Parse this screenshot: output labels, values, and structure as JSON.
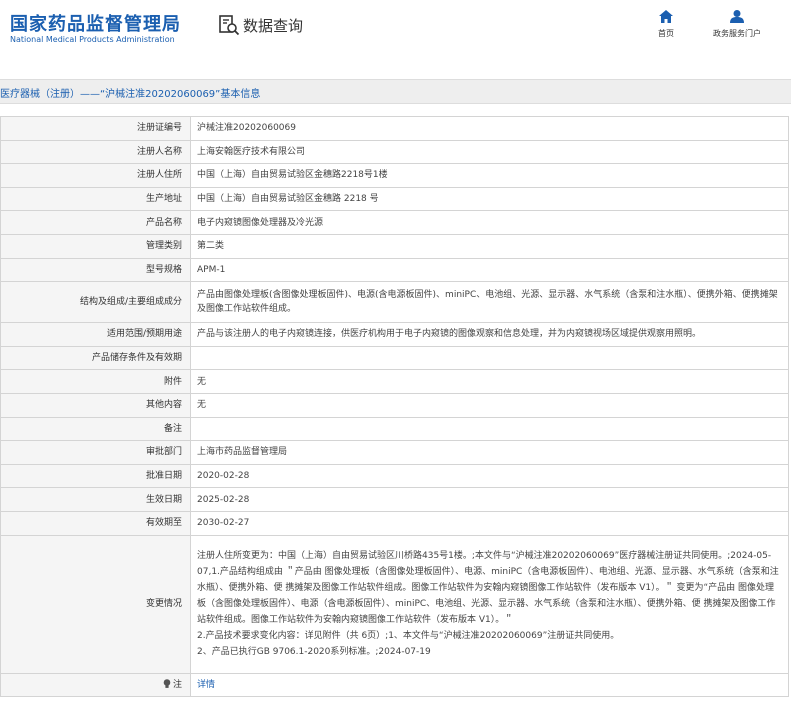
{
  "header": {
    "logo_cn": "国家药品监督管理局",
    "logo_en": "National Medical Products Administration",
    "query_label": "数据查询",
    "nav": [
      {
        "label": "首页",
        "icon": "home-icon"
      },
      {
        "label": "政务服务门户",
        "icon": "user-icon"
      }
    ]
  },
  "title": "医疗器械（注册）——“沪械注准20202060069”基本信息",
  "colors": {
    "brand": "#1b5fb0",
    "label_bg": "#f5f5f5",
    "border": "#d4d4d4"
  },
  "rows": [
    {
      "label": "注册证编号",
      "value": "沪械注准20202060069"
    },
    {
      "label": "注册人名称",
      "value": "上海安翰医疗技术有限公司"
    },
    {
      "label": "注册人住所",
      "value": "中国（上海）自由贸易试验区金穗路2218号1楼"
    },
    {
      "label": "生产地址",
      "value": "中国（上海）自由贸易试验区金穗路 2218 号"
    },
    {
      "label": "产品名称",
      "value": "电子内窥镜图像处理器及冷光源"
    },
    {
      "label": "管理类别",
      "value": "第二类"
    },
    {
      "label": "型号规格",
      "value": "APM-1"
    },
    {
      "label": "结构及组成/主要组成成分",
      "value": "产品由图像处理板(含图像处理板固件)、电源(含电源板固件)、miniPC、电池组、光源、显示器、水气系统（含泵和注水瓶）、便携外箱、便携摊架及图像工作站软件组成。"
    },
    {
      "label": "适用范围/预期用途",
      "value": "产品与该注册人的电子内窥镜连接，供医疗机构用于电子内窥镜的图像观察和信息处理，并为内窥镜视场区域提供观察用照明。"
    },
    {
      "label": "产品储存条件及有效期",
      "value": ""
    },
    {
      "label": "附件",
      "value": "无"
    },
    {
      "label": "其他内容",
      "value": "无"
    },
    {
      "label": "备注",
      "value": ""
    },
    {
      "label": "审批部门",
      "value": "上海市药品监督管理局"
    },
    {
      "label": "批准日期",
      "value": "2020-02-28"
    },
    {
      "label": "生效日期",
      "value": "2025-02-28"
    },
    {
      "label": "有效期至",
      "value": "2030-02-27"
    }
  ],
  "change": {
    "label": "变更情况",
    "paragraphs": [
      "注册人住所变更为：中国（上海）自由贸易试验区川桥路435号1楼。;本文件与“沪械注准20202060069”医疗器械注册证共同使用。;2024-05-07,1.产品结构组成由 ＂产品由 图像处理板（含图像处理板固件）、电源、miniPC（含电源板固件）、电池组、光源、显示器、水气系统（含泵和注水瓶）、便携外箱、便 携摊架及图像工作站软件组成。图像工作站软件为安翰内窥镜图像工作站软件（发布版本 V1）。＂ 变更为“产品由 图像处理板（含图像处理板固件）、电源（含电源板固件）、miniPC、电池组、光源、显示器、水气系统（含泵和注水瓶）、便携外箱、便 携摊架及图像工作站软件组成。图像工作站软件为安翰内窥镜图像工作站软件（发布版本 V1）。＂",
      "2.产品技术要求变化内容：详见附件（共 6页）;1、本文件与“沪械注准20202060069”注册证共同使用。",
      "2、产品已执行GB 9706.1-2020系列标准。;2024-07-19"
    ]
  },
  "note": {
    "label": "注",
    "link": "详情",
    "icon": "lightbulb-icon"
  }
}
